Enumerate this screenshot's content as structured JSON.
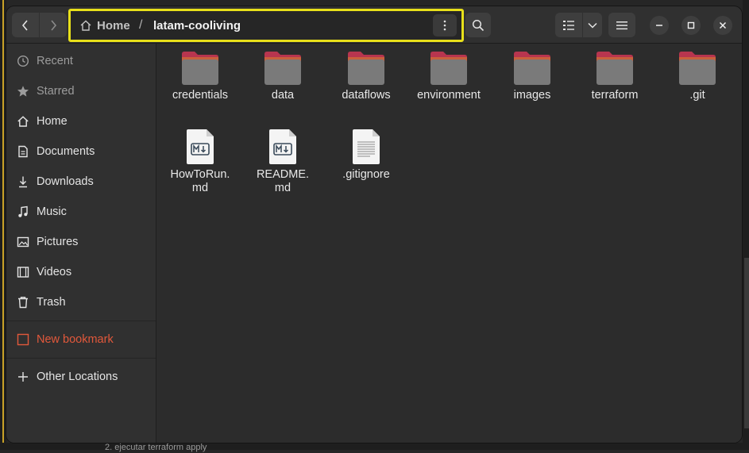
{
  "background": {
    "bottom_text": "2. ejecutar terraform apply"
  },
  "window": {
    "path": {
      "home_label": "Home",
      "separator": "/",
      "current": "latam-cooliving"
    }
  },
  "sidebar": {
    "items": [
      {
        "label": "Recent",
        "icon": "clock-icon"
      },
      {
        "label": "Starred",
        "icon": "star-icon"
      },
      {
        "label": "Home",
        "icon": "home-icon"
      },
      {
        "label": "Documents",
        "icon": "document-icon"
      },
      {
        "label": "Downloads",
        "icon": "download-icon"
      },
      {
        "label": "Music",
        "icon": "music-icon"
      },
      {
        "label": "Pictures",
        "icon": "picture-icon"
      },
      {
        "label": "Videos",
        "icon": "video-icon"
      },
      {
        "label": "Trash",
        "icon": "trash-icon"
      }
    ],
    "bookmark": {
      "label": "New bookmark"
    },
    "other": {
      "label": "Other Locations",
      "icon": "plus-icon"
    }
  },
  "files": [
    {
      "name": "credentials",
      "type": "folder"
    },
    {
      "name": "data",
      "type": "folder"
    },
    {
      "name": "dataflows",
      "type": "folder"
    },
    {
      "name": "environment",
      "type": "folder"
    },
    {
      "name": "images",
      "type": "folder"
    },
    {
      "name": "terraform",
      "type": "folder"
    },
    {
      "name": ".git",
      "type": "folder"
    },
    {
      "name": "HowToRun.md",
      "type": "markdown"
    },
    {
      "name": "README.md",
      "type": "markdown"
    },
    {
      "name": ".gitignore",
      "type": "text"
    }
  ],
  "colors": {
    "folder_tab": "#b8354f",
    "folder_body": "#7a7a7a",
    "highlight_border": "#e8e01a",
    "bookmark_accent": "#e2583b"
  }
}
